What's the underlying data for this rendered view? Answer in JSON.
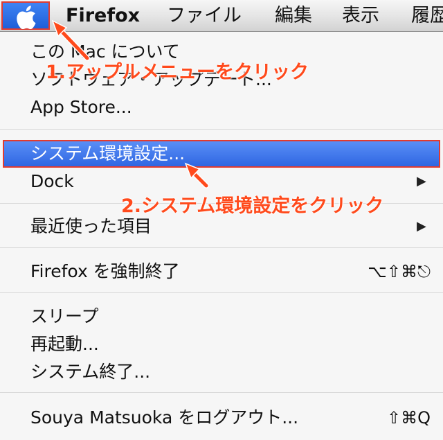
{
  "menubar": {
    "apple_icon": "apple-logo-icon",
    "items": [
      "Firefox",
      "ファイル",
      "編集",
      "表示",
      "履歴"
    ]
  },
  "apple_menu": {
    "items": [
      {
        "label": "この Mac について"
      },
      {
        "label": "ソフトウェア・アップデート..."
      },
      {
        "label": "App Store..."
      },
      {
        "label": "システム環境設定..."
      },
      {
        "label": "Dock",
        "submenu_icon": "triangle-right-icon"
      },
      {
        "label": "最近使った項目",
        "submenu_icon": "triangle-right-icon"
      },
      {
        "label": "Firefox を強制終了",
        "shortcut": "⌥⇧⌘⎋"
      },
      {
        "label": "スリープ"
      },
      {
        "label": "再起動..."
      },
      {
        "label": "システム終了..."
      },
      {
        "label": "Souya Matsuoka をログアウト...",
        "shortcut": "⇧⌘Q"
      }
    ]
  },
  "annotations": {
    "step1": "1.アップルメニューをクリック",
    "step2": "2.システム環境設定をクリック"
  },
  "colors": {
    "highlight": "#3a72e8",
    "annotation": "#ff4a1c",
    "annotation_border": "#e23b2e"
  }
}
